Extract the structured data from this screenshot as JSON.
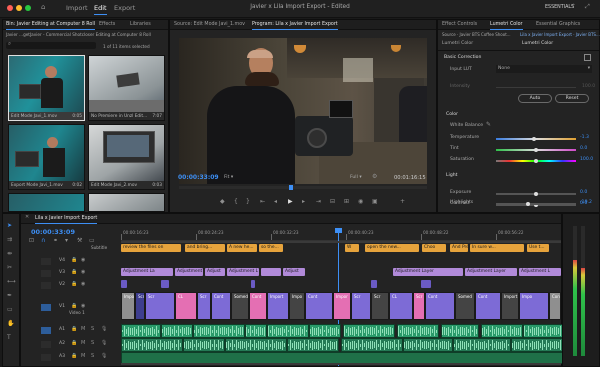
{
  "menu": {
    "items": [
      "Import",
      "Edit",
      "Export"
    ],
    "active": "Edit"
  },
  "window_title": "Javier x Lila Import Export - Edited",
  "workspace": {
    "label": "ESSENTIALS"
  },
  "project": {
    "tabs": [
      "Bin: Javier Editing at Computer 8 Roll",
      "Effects",
      "Libraries"
    ],
    "path": "Javier ...getJavier - Commercial Shotcloser Editing at Computer 8 Roll",
    "count": "1 of 11 items selected",
    "items": [
      {
        "name": "Edit Mode Javi_1.mov",
        "dur": "0:05"
      },
      {
        "name": "No Premiere in Unzl Edit...",
        "dur": "7:07"
      },
      {
        "name": "Export Mode Javi_1.mov",
        "dur": "0:02"
      },
      {
        "name": "Edit Mode Javi_2.mov",
        "dur": "0:03"
      }
    ]
  },
  "source_tab": "Source: Edit Mode Javi_1.mov",
  "program": {
    "tab": "Program: Lila x Javier Import Export",
    "timecode": "00:00:33:09",
    "fit": "Fit",
    "quality": "Full",
    "duration": "00:01:16:15"
  },
  "lumetri": {
    "tabs": [
      "Effect Controls",
      "Lumetri Color",
      "Essential Graphics"
    ],
    "source_line": "Source · Javier BTS Coffee Shoot...",
    "sequence_line": "Lila x Javier Import Export · Javier BTS...",
    "preset_source": "Lumetri Color",
    "preset_seq": "Lumetri Color",
    "basic_heading": "Basic Correction",
    "input_lut_label": "Input LUT",
    "input_lut_value": "None",
    "intensity_label": "Intensity",
    "intensity_value": "100.0",
    "auto_label": "Auto",
    "reset_label": "Reset",
    "color_heading": "Color",
    "white_balance_label": "White Balance",
    "light_heading": "Light",
    "sliders": [
      {
        "label": "Temperature",
        "value": "-1.3",
        "level": 0.47
      },
      {
        "label": "Tint",
        "value": "0.0",
        "level": 0.5
      },
      {
        "label": "Saturation",
        "value": "100.0",
        "level": 0.5
      },
      {
        "label": "Exposure",
        "value": "0.0",
        "level": 0.5
      },
      {
        "label": "Contrast",
        "value": "0.0",
        "level": 0.5
      },
      {
        "label": "Highlights",
        "value": "-19.2",
        "level": 0.4
      }
    ]
  },
  "timeline": {
    "tab": "Lila x Javier Import Export",
    "timecode": "00:00:33:09",
    "ruler": [
      "00:00:16:23",
      "00:00:24:23",
      "00:00:32:23",
      "00:00:40:23",
      "00:00:48:22",
      "00:00:56:22"
    ],
    "subtitle_label": "Subtitle",
    "subtitles": [
      "review the files on",
      "and bring...",
      "A new he...",
      "so the...",
      "W",
      "open the new...",
      "Choo",
      "And Pre...",
      "In sure w...",
      "Use t..."
    ],
    "adjust": [
      "Adjustment La",
      "Adjustment Lay",
      "Adjustment L",
      "Adjust",
      "Adjustment Layer",
      "Adjust",
      "Adjustment Layer",
      "Adjustment L"
    ],
    "video1_label": "Video 1",
    "tracks": [
      "V4",
      "V3",
      "V2",
      "V1",
      "A1",
      "A2",
      "A3"
    ],
    "video_clips": [
      "Impor",
      "Scr",
      "Scr",
      "CL",
      "Scr",
      "Cont",
      "Somed",
      "Cont",
      "Import",
      "Impo",
      "Cont"
    ]
  },
  "colors": {
    "accent": "#3d8ff5",
    "subtitle": "#e6a33c",
    "adjust": "#b18ad9",
    "video": "#7d6bd6",
    "audio": "#2a9a6a",
    "pink": "#e46fb3"
  }
}
